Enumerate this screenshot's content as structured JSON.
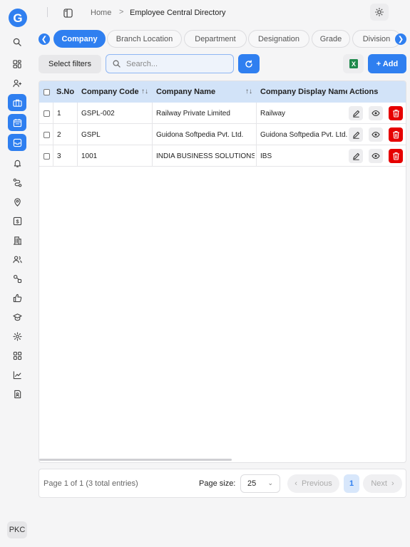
{
  "app": {
    "logo_letter": "G",
    "brand_color": "#2f7ff0",
    "user_initials": "PKC"
  },
  "sidebar": {
    "items": [
      {
        "icon": "search-icon"
      },
      {
        "icon": "dashboard-icon"
      },
      {
        "icon": "add-user-icon"
      },
      {
        "icon": "briefcase-icon",
        "active": true
      },
      {
        "icon": "calendar-icon",
        "active": true
      },
      {
        "icon": "inbox-icon",
        "active": true
      },
      {
        "icon": "bell-icon"
      },
      {
        "icon": "route-icon"
      },
      {
        "icon": "location-pin-icon"
      },
      {
        "icon": "money-icon"
      },
      {
        "icon": "building-icon"
      },
      {
        "icon": "users-icon"
      },
      {
        "icon": "workflow-icon"
      },
      {
        "icon": "thumbs-up-icon"
      },
      {
        "icon": "graduation-cap-icon"
      },
      {
        "icon": "gear-icon"
      },
      {
        "icon": "apps-icon"
      },
      {
        "icon": "chart-icon"
      },
      {
        "icon": "contact-icon"
      }
    ]
  },
  "header": {
    "breadcrumb": {
      "home": "Home",
      "separator": ">",
      "current": "Employee Central Directory"
    }
  },
  "tabs": [
    {
      "label": "Company",
      "active": true
    },
    {
      "label": "Branch Location"
    },
    {
      "label": "Department"
    },
    {
      "label": "Designation"
    },
    {
      "label": "Grade"
    },
    {
      "label": "Division"
    }
  ],
  "toolbar": {
    "filters_label": "Select filters",
    "search_placeholder": "Search...",
    "add_label": "+ Add"
  },
  "table": {
    "columns": [
      "S.No",
      "Company Code",
      "Company Name",
      "Company Display Name",
      "Actions"
    ],
    "rows": [
      {
        "sno": "1",
        "code": "GSPL-002",
        "name": "Railway Private Limited",
        "display": "Railway"
      },
      {
        "sno": "2",
        "code": "GSPL",
        "name": "Guidona Softpedia Pvt. Ltd.",
        "display": "Guidona Softpedia Pvt. Ltd."
      },
      {
        "sno": "3",
        "code": "1001",
        "name": "INDIA BUSINESS SOLUTIONS",
        "display": "IBS"
      }
    ]
  },
  "pagination": {
    "summary": "Page 1 of 1 (3 total entries)",
    "page_size_label": "Page size:",
    "page_size": "25",
    "prev_label": "Previous",
    "current_page": "1",
    "next_label": "Next"
  }
}
